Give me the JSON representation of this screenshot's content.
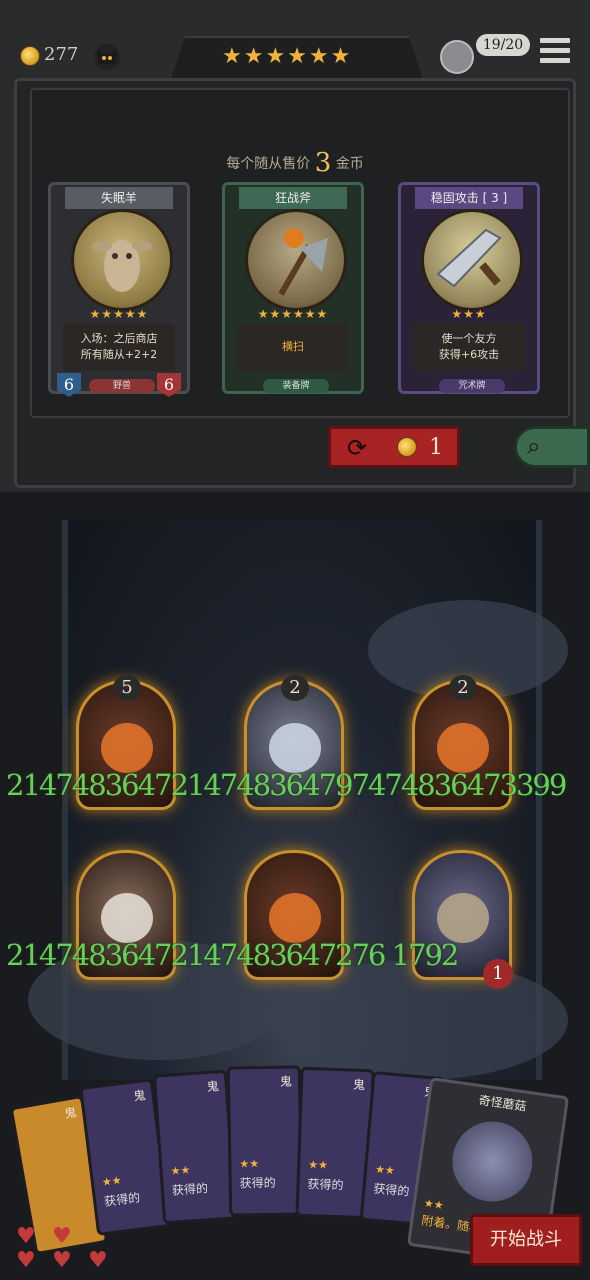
{
  "topbar": {
    "gold": "277",
    "stars": "★★★★★★",
    "turn": "19/20"
  },
  "shop": {
    "price_prefix": "每个随从售价",
    "price_value": "3",
    "price_suffix": "金币",
    "cards": [
      {
        "title": "失眠羊",
        "stars": "★★★★★",
        "desc_line1": "入场：之后商店",
        "desc_line2": "所有随从+2+2",
        "tag": "野兽",
        "attack": "6",
        "health": "6"
      },
      {
        "title": "狂战斧",
        "stars": "★★★★★★",
        "desc_line1": "横扫",
        "desc_line2": "",
        "tag": "装备牌"
      },
      {
        "title": "稳固攻击 [ 3 ]",
        "stars": "★★★",
        "desc_line1": "使一个友方",
        "desc_line2": "获得+6攻击",
        "tag": "咒术牌"
      }
    ],
    "refresh_cost": "1"
  },
  "board": {
    "row1": [
      {
        "tier": "5"
      },
      {
        "tier": "2"
      },
      {
        "tier": "2"
      }
    ],
    "row1_stats": "2147483647214748364797474836473399",
    "row2_stats": "21474836472147483647276 1792",
    "row2_last_health": "1"
  },
  "hand": {
    "cards": [
      {
        "title": "鬼",
        "desc": ""
      },
      {
        "title": "鬼",
        "desc": "获得的"
      },
      {
        "title": "鬼",
        "desc": "获得的"
      },
      {
        "title": "鬼",
        "desc": "获得的"
      },
      {
        "title": "鬼",
        "desc": "获得的"
      },
      {
        "title": "鬼",
        "desc": "获得的"
      },
      {
        "title": "奇怪蘑菇",
        "desc": "附着。随机"
      }
    ]
  },
  "start_button": "开始战斗",
  "colors": {
    "gold": "#f0b23a",
    "red": "#a82323",
    "green_numbers": "#68d05a"
  }
}
